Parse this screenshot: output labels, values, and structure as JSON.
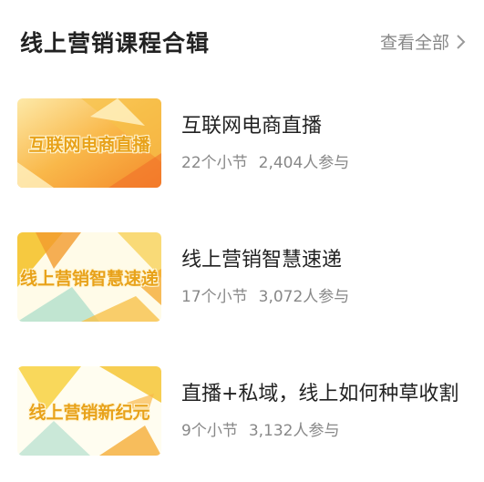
{
  "header": {
    "title": "线上营销课程合辑",
    "view_all": "查看全部"
  },
  "courses": [
    {
      "thumb_text": "互联网电商直播",
      "title": "互联网电商直播",
      "sections": "22个小节",
      "participants": "2,404人参与"
    },
    {
      "thumb_text": "线上营销智慧速递",
      "title": "线上营销智慧速递",
      "sections": "17个小节",
      "participants": "3,072人参与"
    },
    {
      "thumb_text": "线上营销新纪元",
      "title": "直播+私域，线上如何种草收割",
      "sections": "9个小节",
      "participants": "3,132人参与"
    }
  ],
  "colors": {
    "accent_orange": "#f4a11c",
    "accent_yellow": "#f8d44a",
    "text_primary": "#222222",
    "text_secondary": "#888888"
  },
  "icons": {
    "view_all": "chevron-right-icon"
  }
}
